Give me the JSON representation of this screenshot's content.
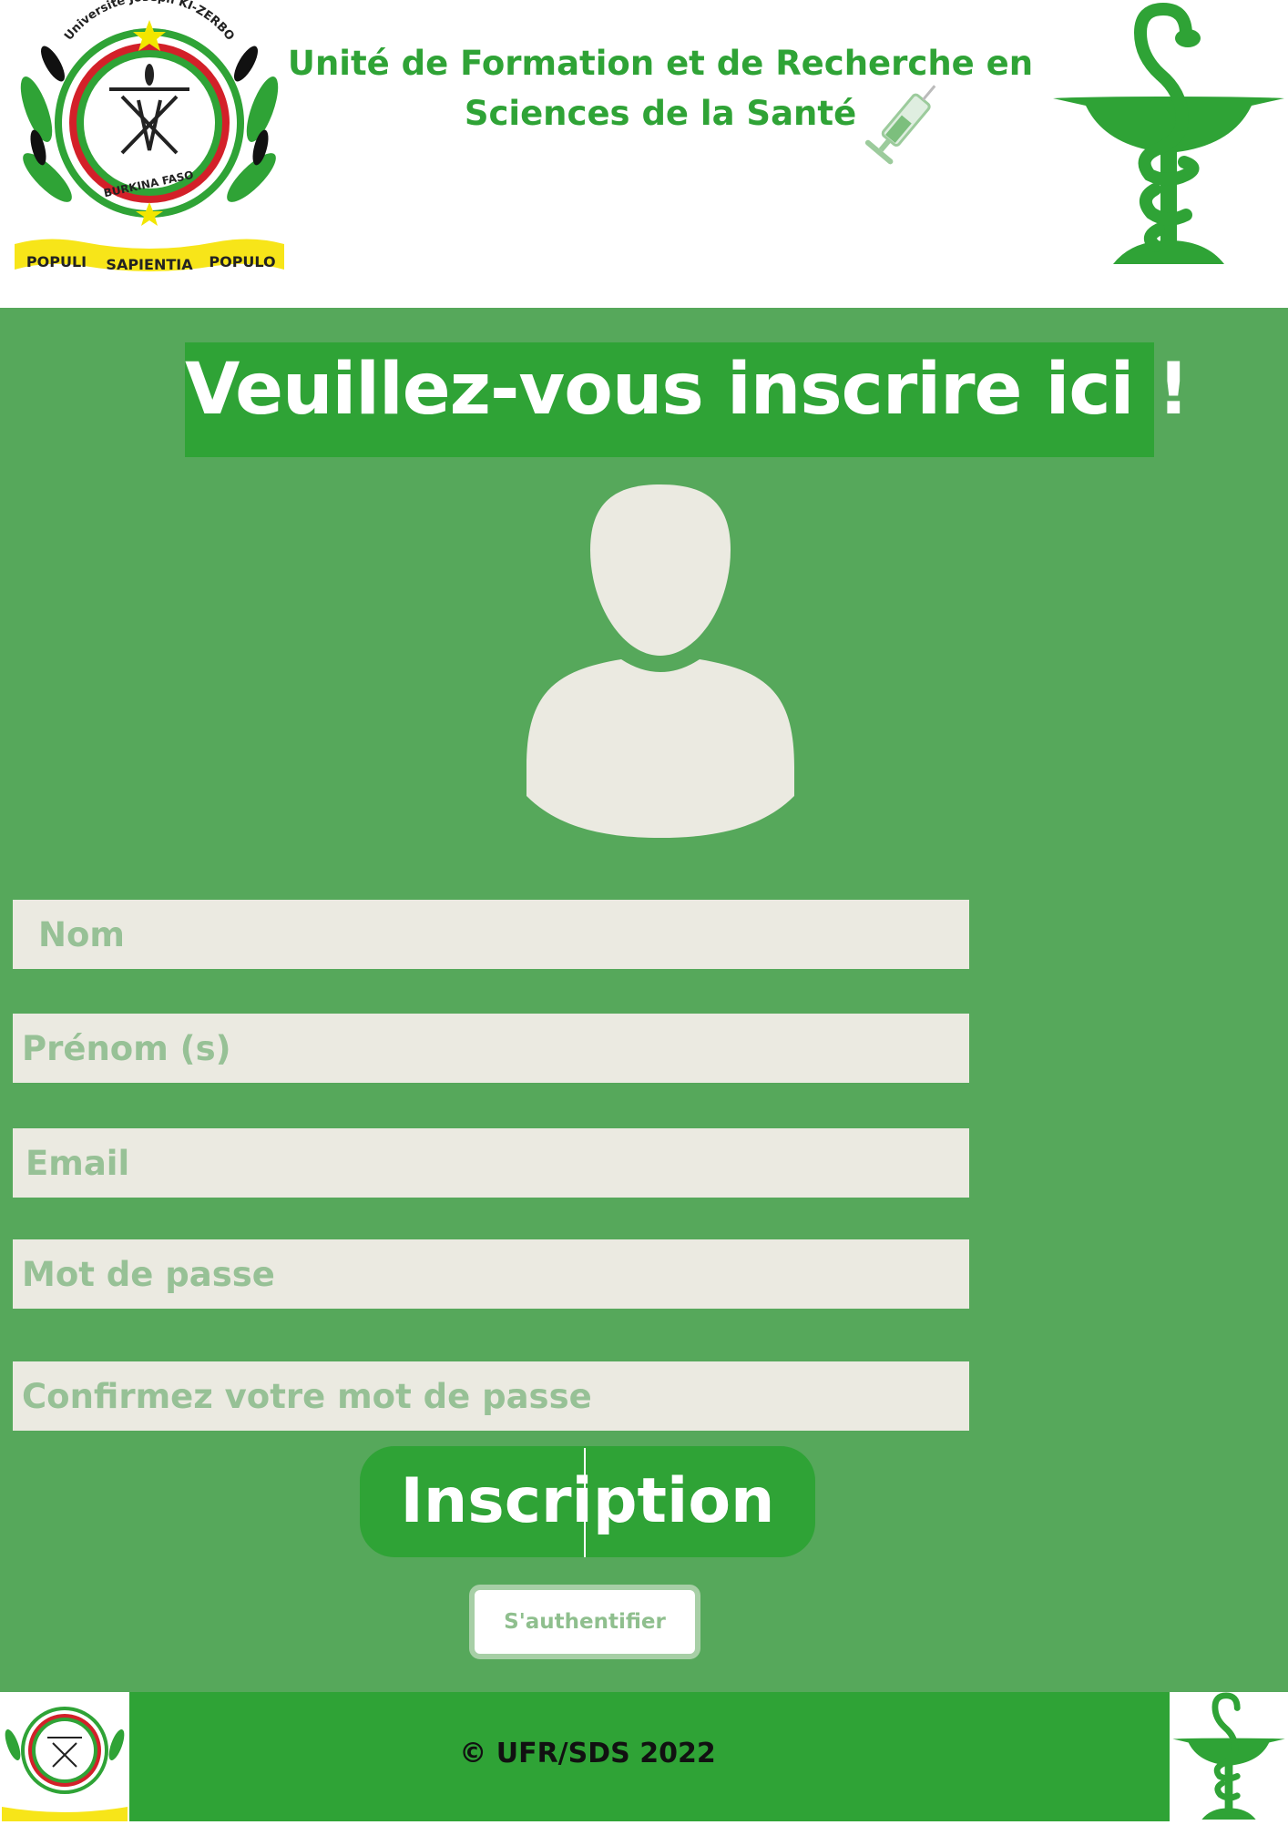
{
  "header": {
    "logo_univ": {
      "top_text": "Université Joseph KI-ZERBO",
      "country": "BURKINA FASO",
      "motto": [
        "POPULI",
        "SAPIENTIA",
        "POPULO"
      ]
    },
    "title_line1": "Unité de Formation et de Recherche en",
    "title_line2": "Sciences de la Santé",
    "icons": [
      "university-seal-icon",
      "syringe-icon",
      "caduceus-icon"
    ]
  },
  "form": {
    "title": "Veuillez-vous inscrire ici !",
    "avatar_icon": "user-avatar-icon",
    "fields": {
      "nom": {
        "placeholder": "Nom",
        "value": ""
      },
      "prenom": {
        "placeholder": "Prénom (s)",
        "value": ""
      },
      "email": {
        "placeholder": "Email",
        "value": ""
      },
      "password": {
        "placeholder": "Mot de passe",
        "value": ""
      },
      "confirm": {
        "placeholder": "Confirmez votre mot de passe",
        "value": ""
      }
    },
    "submit_label": "Inscription",
    "auth_label": "S'authentifier"
  },
  "footer": {
    "copyright": "© UFR/SDS 2022"
  },
  "colors": {
    "primary_green": "#2fa336",
    "main_background": "#56a85b",
    "field_background": "#ebeae1",
    "placeholder": "#97c196",
    "avatar": "#ebeae1"
  }
}
